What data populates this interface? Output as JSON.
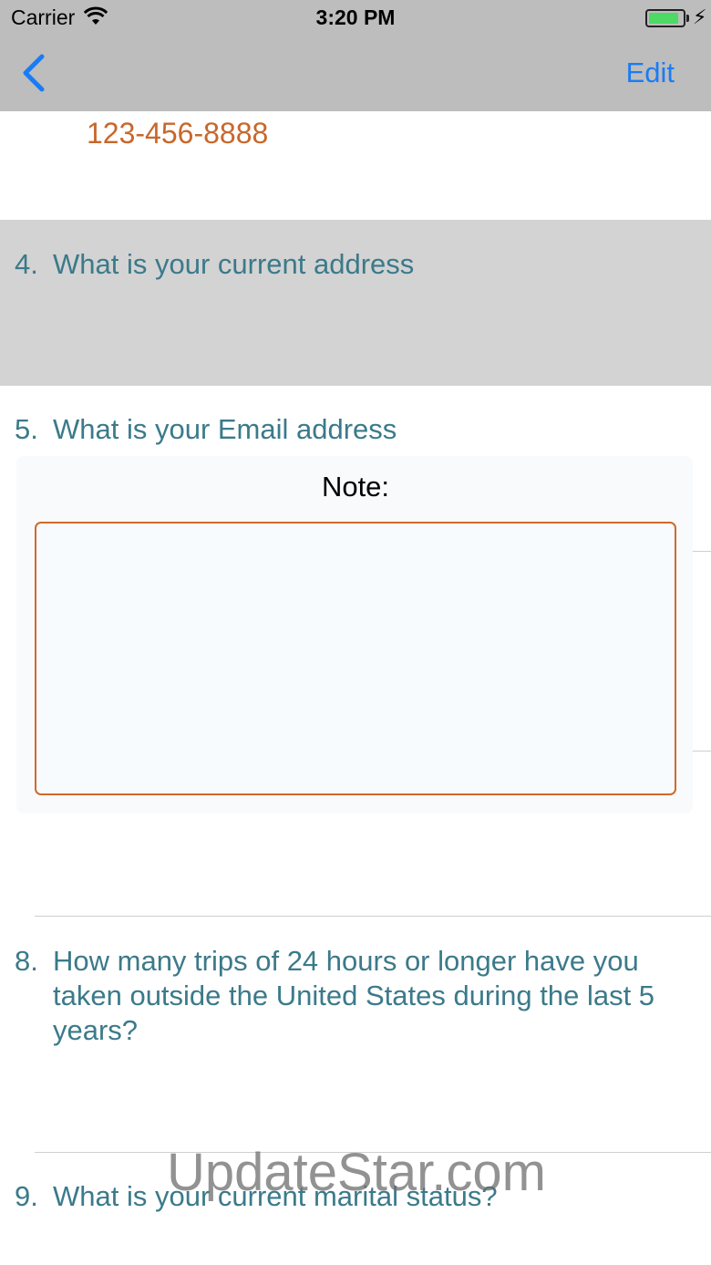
{
  "status": {
    "carrier": "Carrier",
    "time": "3:20 PM",
    "battery_level": 0.8
  },
  "nav": {
    "back_icon": "chevron-left-icon",
    "edit_label": "Edit"
  },
  "answer_phone": "123-456-8888",
  "questions": [
    {
      "number": "4.",
      "text": "What is your current address"
    },
    {
      "number": "5.",
      "text": "What is your Email address"
    },
    {
      "number": "8.",
      "text": "How many trips of 24 hours or longer have you taken outside the United States during the last 5 years?"
    },
    {
      "number": "9.",
      "text": "What is your current marital status?"
    }
  ],
  "note": {
    "label": "Note:",
    "value": ""
  },
  "watermark": "UpdateStar.com",
  "colors": {
    "nav_bg": "#bdbdbd",
    "accent_blue": "#1a7cf5",
    "question_text": "#3b7a8a",
    "answer_text": "#c8672b",
    "highlight_row": "#d3d3d3",
    "note_border": "#d2692b"
  }
}
